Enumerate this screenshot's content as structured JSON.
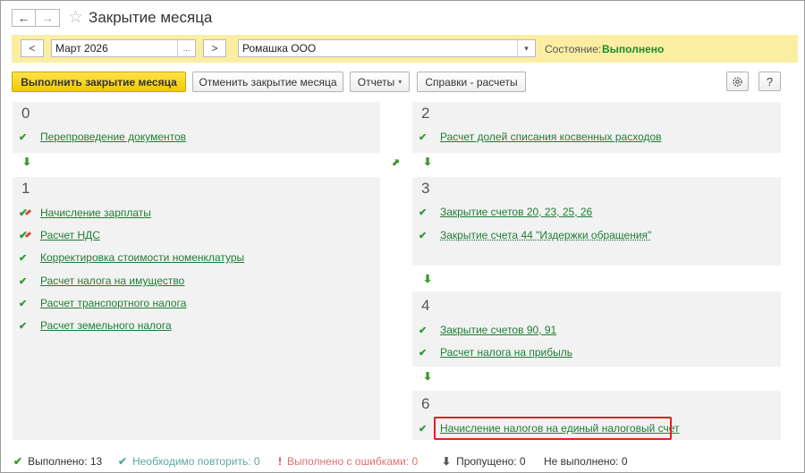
{
  "window": {
    "title": "Закрытие месяца",
    "back_label": "←",
    "forward_label": "→",
    "favorite_label": "☆"
  },
  "params": {
    "prev_label": "<",
    "period_value": "Март 2026",
    "period_select_label": "...",
    "next_label": ">",
    "organization_value": "Ромашка ООО",
    "organization_dropdown_label": "▾",
    "state_label": "Состояние:",
    "state_value": "Выполнено"
  },
  "toolbar": {
    "run_label": "Выполнить закрытие месяца",
    "cancel_label": "Отменить закрытие месяца",
    "reports_label": "Отчеты",
    "references_label": "Справки - расчеты",
    "dropdown_glyph": "▾",
    "settings_icon": "gear-icon",
    "help_label": "?"
  },
  "steps": [
    {
      "number": "0",
      "items": [
        {
          "label": "Перепроведение документов",
          "status": "done"
        }
      ]
    },
    {
      "number": "1",
      "items": [
        {
          "label": "Начисление зарплаты",
          "status": "done-manual"
        },
        {
          "label": "Расчет НДС",
          "status": "done-manual"
        },
        {
          "label": "Корректировка стоимости номенклатуры",
          "status": "done"
        },
        {
          "label": "Расчет налога на имущество",
          "status": "done"
        },
        {
          "label": "Расчет транспортного налога",
          "status": "done"
        },
        {
          "label": "Расчет земельного налога",
          "status": "done"
        }
      ]
    },
    {
      "number": "2",
      "items": [
        {
          "label": "Расчет долей списания косвенных расходов",
          "status": "done"
        }
      ]
    },
    {
      "number": "3",
      "items": [
        {
          "label": "Закрытие счетов 20, 23, 25, 26",
          "status": "done"
        },
        {
          "label": "Закрытие счета 44 \"Издержки обращения\"",
          "status": "done"
        }
      ]
    },
    {
      "number": "4",
      "items": [
        {
          "label": "Закрытие счетов 90, 91",
          "status": "done"
        },
        {
          "label": "Расчет налога на прибыль",
          "status": "done"
        }
      ]
    },
    {
      "number": "6",
      "items": [
        {
          "label": "Начисление налогов на единый налоговый счет",
          "status": "done"
        }
      ]
    }
  ],
  "statusbar": {
    "done": "Выполнено: 13",
    "repeat": "Необходимо повторить: 0",
    "errors": "Выполнено с ошибками: 0",
    "skipped": "Пропущено: 0",
    "not_done": "Не выполнено: 0"
  },
  "colors": {
    "accent_yellow": "#fbeea3",
    "primary_button": "#f1c800",
    "done_green": "#2e9a3a",
    "link_green": "#1e7d34",
    "repeat_teal": "#5aa7a0",
    "error_red": "#e07070",
    "highlight_red": "#e02020",
    "panel_gray": "#f2f2f2"
  }
}
